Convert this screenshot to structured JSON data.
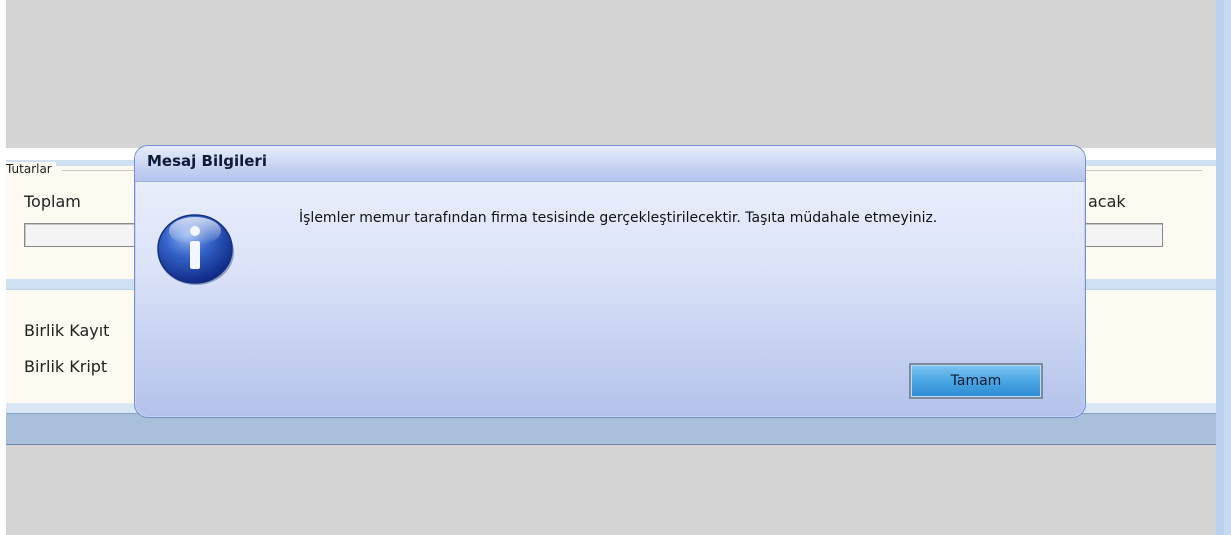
{
  "background": {
    "tutarlar": {
      "group_title": "Tutarlar",
      "toplam_label": "Toplam",
      "right_label_fragment": "acak"
    },
    "birlik": {
      "kayit_label_fragment": "Birlik Kayıt",
      "kripto_label_fragment": "Birlik Kript"
    }
  },
  "dialog": {
    "title": "Mesaj Bilgileri",
    "icon": "info-icon",
    "message": "İşlemler memur tarafından firma tesisinde gerçekleştirilecektir. Taşıta müdahale etmeyiniz.",
    "ok_label": "Tamam"
  },
  "colors": {
    "page_bg": "#d4d4d4",
    "panel_bg": "#fdfaf1",
    "footer_bar": "#a9bfda",
    "button_blue": "#4aa5e3"
  }
}
